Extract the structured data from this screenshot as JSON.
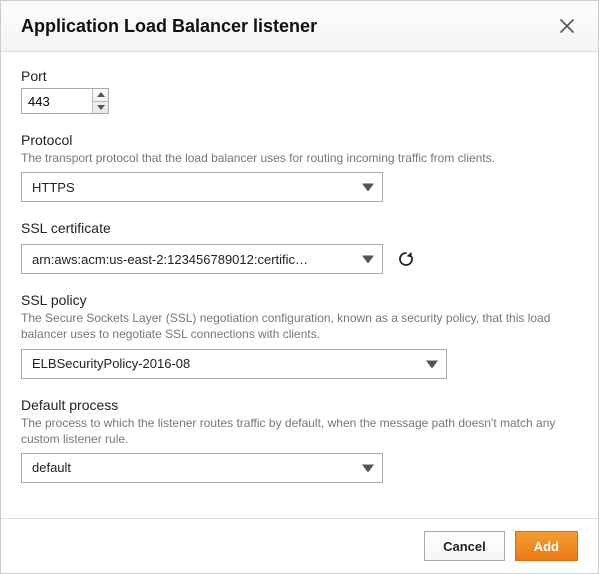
{
  "dialog": {
    "title": "Application Load Balancer listener"
  },
  "port": {
    "label": "Port",
    "value": "443"
  },
  "protocol": {
    "label": "Protocol",
    "help": "The transport protocol that the load balancer uses for routing incoming traffic from clients.",
    "value": "HTTPS"
  },
  "cert": {
    "label": "SSL certificate",
    "value": "arn:aws:acm:us-east-2:123456789012:certific…"
  },
  "policy": {
    "label": "SSL policy",
    "help": "The Secure Sockets Layer (SSL) negotiation configuration, known as a security policy, that this load balancer uses to negotiate SSL connections with clients.",
    "value": "ELBSecurityPolicy-2016-08"
  },
  "process": {
    "label": "Default process",
    "help": "The process to which the listener routes traffic by default, when the message path doesn't match any custom listener rule.",
    "value": "default"
  },
  "footer": {
    "cancel": "Cancel",
    "add": "Add"
  }
}
